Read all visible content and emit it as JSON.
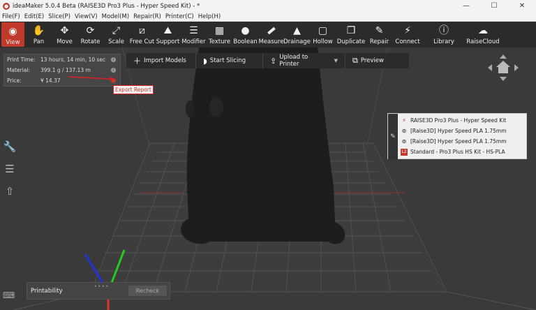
{
  "window": {
    "title": "ideaMaker 5.0.4 Beta (RAISE3D Pro3 Plus - Hyper Speed Kit) - *",
    "app_icon": "ideamaker-logo",
    "controls": {
      "minimize": "—",
      "maximize": "☐",
      "close": "✕"
    }
  },
  "menubar": {
    "items": [
      "File(F)",
      "Edit(E)",
      "Slice(P)",
      "View(V)",
      "Model(M)",
      "Repair(R)",
      "Printer(C)",
      "Help(H)"
    ]
  },
  "toolbar": {
    "tools": [
      {
        "label": "View",
        "icon": "eye-icon",
        "glyph": "◉"
      },
      {
        "label": "Pan",
        "icon": "hand-icon",
        "glyph": "✋"
      },
      {
        "label": "Move",
        "icon": "move-icon",
        "glyph": "✥"
      },
      {
        "label": "Rotate",
        "icon": "rotate-icon",
        "glyph": "⟳"
      },
      {
        "label": "Scale",
        "icon": "scale-icon",
        "glyph": "⤢"
      },
      {
        "label": "Free Cut",
        "icon": "cut-icon",
        "glyph": "⧄"
      },
      {
        "label": "Support",
        "icon": "support-icon",
        "glyph": "⛰"
      },
      {
        "label": "Modifier",
        "icon": "sliders-icon",
        "glyph": "☰"
      },
      {
        "label": "Texture",
        "icon": "texture-icon",
        "glyph": "▦"
      },
      {
        "label": "Boolean",
        "icon": "boolean-icon",
        "glyph": "●"
      },
      {
        "label": "Measure",
        "icon": "ruler-icon",
        "glyph": "📏"
      },
      {
        "label": "Drainage",
        "icon": "drainage-icon",
        "glyph": "▲"
      },
      {
        "label": "Hollow",
        "icon": "hollow-icon",
        "glyph": "▢"
      },
      {
        "label": "Duplicate",
        "icon": "duplicate-icon",
        "glyph": "❐"
      },
      {
        "label": "Repair",
        "icon": "wrench-icon",
        "glyph": "✎"
      },
      {
        "label": "Connect",
        "icon": "connect-icon",
        "glyph": "⚡"
      },
      {
        "label": "Library",
        "icon": "info-hex-icon",
        "glyph": "ⓘ"
      },
      {
        "label": "RaiseCloud",
        "icon": "cloud-icon",
        "glyph": "☁"
      }
    ]
  },
  "info": {
    "print_time_label": "Print Time:",
    "print_time_value": "13 hours, 14 min, 10 sec",
    "material_label": "Material:",
    "material_value": "399.1 g / 137.13 m",
    "price_label": "Price:",
    "price_value": "¥  14.37",
    "export_report": "Export Report"
  },
  "actions": {
    "import": "Import Models",
    "slice": "Start Slicing",
    "upload": "Upload to Printer",
    "preview": "Preview"
  },
  "profile": {
    "printer": "RAISE3D Pro3 Plus - Hyper Speed Kit",
    "filament_1": "[Raise3D] Hyper Speed PLA 1.75mm",
    "filament_2": "[Raise3D] Hyper Speed PLA 1.75mm",
    "template": "Standard - Pro3 Plus HS Kit - HS-PLA",
    "badge_text": "L2"
  },
  "printability": {
    "title": "Printability",
    "recheck": "Recheck"
  },
  "colors": {
    "accent": "#c0392b",
    "toolbar_bg": "#2b2b2b",
    "viewport_bg": "#3a3a3a",
    "axis_x": "#d33",
    "axis_y": "#2c2",
    "axis_z": "#23d"
  }
}
